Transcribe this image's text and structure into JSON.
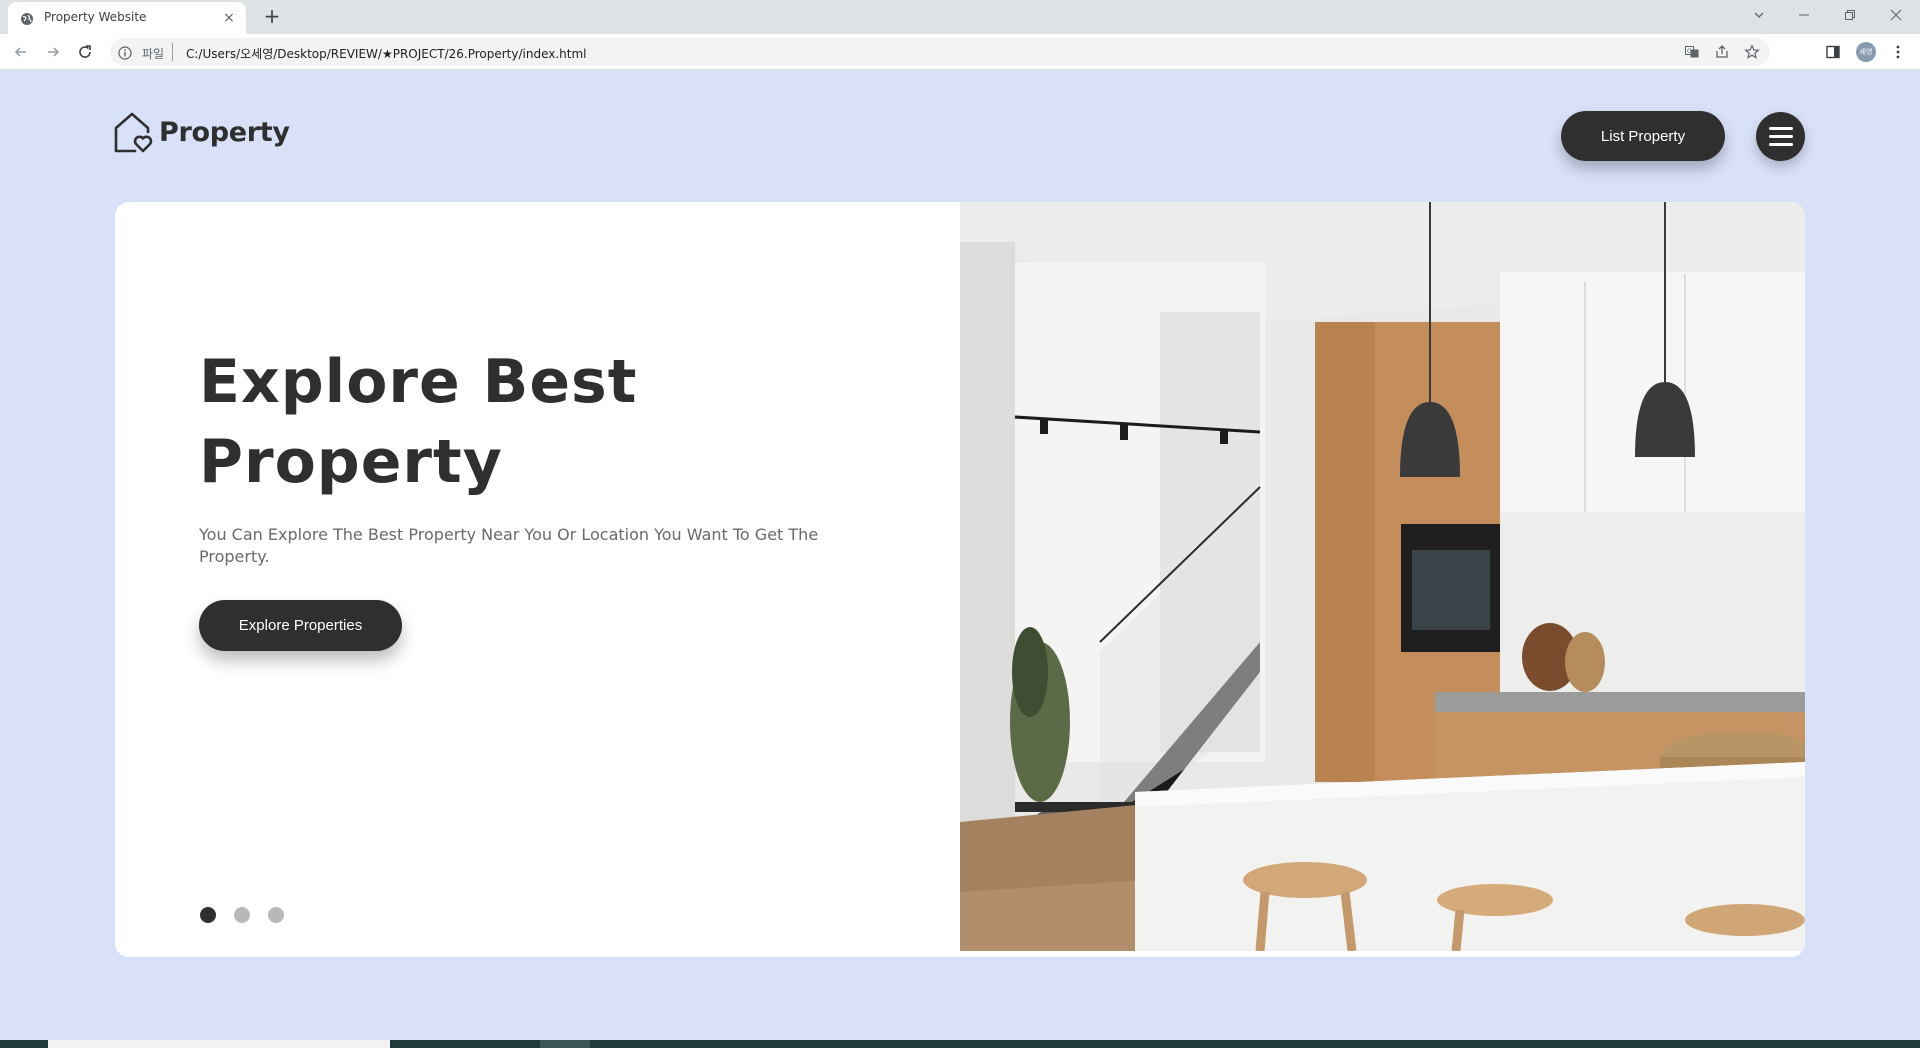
{
  "browser": {
    "tab": {
      "title": "Property Website",
      "close_label": "×"
    },
    "new_tab_label": "+",
    "omnibox": {
      "scheme_label": "파일",
      "url": "C:/Users/오세영/Desktop/REVIEW/★PROJECT/26.Property/index.html"
    },
    "profile_initials": "세영",
    "icons": [
      "back-icon",
      "forward-icon",
      "reload-icon",
      "info-icon",
      "translate-icon",
      "share-icon",
      "bookmark-star-icon",
      "side-panel-icon",
      "kebab-menu-icon",
      "tab-search-icon",
      "minimize-icon",
      "restore-icon",
      "close-window-icon"
    ]
  },
  "header": {
    "logo_text": "Property",
    "list_property_label": "List Property"
  },
  "hero": {
    "title_line1": "Explore Best",
    "title_line2": "Property",
    "subtitle": "You Can Explore The Best Property Near You Or Location You Want To Get The Property.",
    "cta_label": "Explore Properties",
    "slides": {
      "count": 3,
      "active": 1
    },
    "image_description_icon": "kitchen-photo"
  },
  "colors": {
    "page_bg": "#d9e1f9",
    "dark": "#2f2f2f",
    "subtitle": "#6a6a6a",
    "dot_inactive": "#b8b8b8"
  }
}
